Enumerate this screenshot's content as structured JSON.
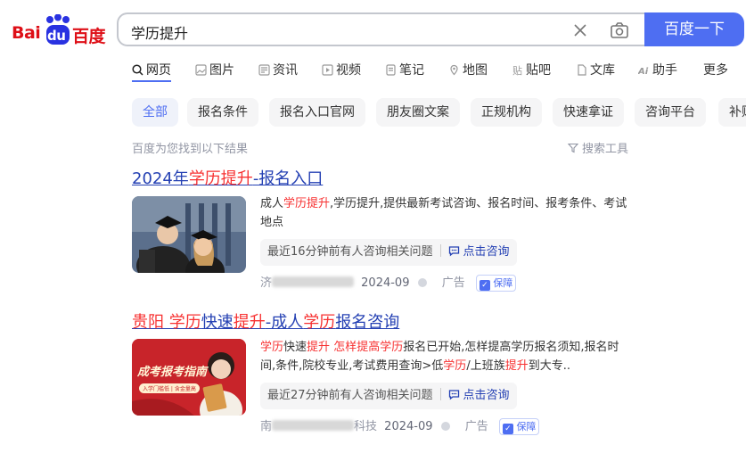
{
  "logo": {
    "left": "Bai",
    "mark": "du",
    "right": "百度"
  },
  "search": {
    "query": "学历提升",
    "button": "百度一下"
  },
  "tabs": [
    "网页",
    "图片",
    "资讯",
    "视频",
    "笔记",
    "地图",
    "贴吧",
    "文库",
    "助手",
    "更多"
  ],
  "chips": [
    "全部",
    "报名条件",
    "报名入口官网",
    "朋友圈文案",
    "正规机构",
    "快速拿证",
    "咨询平台",
    "补贴"
  ],
  "found_text": "百度为您找到以下结果",
  "tools_text": "搜索工具",
  "results": [
    {
      "title_a": "2024年",
      "title_hl": "学历提升",
      "title_b": "-报名入口",
      "desc_a": "成人",
      "desc_hl1": "学历提升",
      "desc_b": ",学历提升,提供最新考试咨询、报名时间、报考条件、考试地点",
      "consult": "最近16分钟前有人咨询相关问题",
      "consult_action": "点击咨询",
      "source_visible": "济",
      "date": "2024-09",
      "ad": "广告",
      "badge": "保障"
    },
    {
      "title_hl1": "贵阳 学历",
      "title_a": "快速",
      "title_hl2": "提升",
      "title_b": "-成人",
      "title_hl3": "学历",
      "title_c": "报名咨询",
      "desc_l1_hl1": "学历",
      "desc_l1_a": "快速",
      "desc_l1_hl2": "提升",
      "desc_l1_b": " ",
      "desc_l1_hl3": "怎样提高学历",
      "desc_l1_c": "报名已开始,怎样提高学历报名须知,报名时",
      "desc_l2_a": "间,条件,院校专业,考试费用查询>低",
      "desc_l2_hl1": "学历",
      "desc_l2_b": "/上班族",
      "desc_l2_hl2": "提升",
      "desc_l2_c": "到大专..",
      "thumb_text": "成考报考指南",
      "thumb_sub": "入学门槛低 | 含金量高",
      "consult": "最近27分钟前有人咨询相关问题",
      "consult_action": "点击咨询",
      "source_visible": "南",
      "source_tail": "科技",
      "date": "2024-09",
      "ad": "广告",
      "badge": "保障"
    }
  ],
  "colors": {
    "accent": "#4e6ef2",
    "link": "#2440b3",
    "highlight": "#f73131"
  }
}
